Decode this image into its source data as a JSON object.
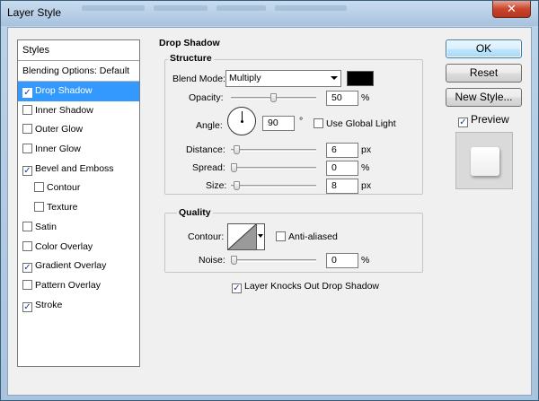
{
  "window": {
    "title": "Layer Style",
    "close_symbol": "✕"
  },
  "styles_list": {
    "header": "Styles",
    "blending_options": "Blending Options: Default",
    "items": [
      {
        "label": "Drop Shadow",
        "checked": true,
        "selected": true,
        "indent": false
      },
      {
        "label": "Inner Shadow",
        "checked": false,
        "selected": false,
        "indent": false
      },
      {
        "label": "Outer Glow",
        "checked": false,
        "selected": false,
        "indent": false
      },
      {
        "label": "Inner Glow",
        "checked": false,
        "selected": false,
        "indent": false
      },
      {
        "label": "Bevel and Emboss",
        "checked": true,
        "selected": false,
        "indent": false
      },
      {
        "label": "Contour",
        "checked": false,
        "selected": false,
        "indent": true
      },
      {
        "label": "Texture",
        "checked": false,
        "selected": false,
        "indent": true
      },
      {
        "label": "Satin",
        "checked": false,
        "selected": false,
        "indent": false
      },
      {
        "label": "Color Overlay",
        "checked": false,
        "selected": false,
        "indent": false
      },
      {
        "label": "Gradient Overlay",
        "checked": true,
        "selected": false,
        "indent": false
      },
      {
        "label": "Pattern Overlay",
        "checked": false,
        "selected": false,
        "indent": false
      },
      {
        "label": "Stroke",
        "checked": true,
        "selected": false,
        "indent": false
      }
    ]
  },
  "drop_shadow": {
    "title": "Drop Shadow",
    "structure": {
      "title": "Structure",
      "blend_mode_label": "Blend Mode:",
      "blend_mode_value": "Multiply",
      "shadow_color": "#000000",
      "opacity_label": "Opacity:",
      "opacity_value": "50",
      "opacity_fraction": 0.5,
      "opacity_unit": "%",
      "angle_label": "Angle:",
      "angle_value": "90",
      "angle_unit": "°",
      "use_global_light_label": "Use Global Light",
      "use_global_light_checked": false,
      "distance_label": "Distance:",
      "distance_value": "6",
      "distance_fraction": 0.03,
      "distance_unit": "px",
      "spread_label": "Spread:",
      "spread_value": "0",
      "spread_fraction": 0.0,
      "spread_unit": "%",
      "size_label": "Size:",
      "size_value": "8",
      "size_fraction": 0.04,
      "size_unit": "px"
    },
    "quality": {
      "title": "Quality",
      "contour_label": "Contour:",
      "anti_aliased_label": "Anti-aliased",
      "anti_aliased_checked": false,
      "noise_label": "Noise:",
      "noise_value": "0",
      "noise_fraction": 0.0,
      "noise_unit": "%"
    },
    "knocks_out_label": "Layer Knocks Out Drop Shadow",
    "knocks_out_checked": true
  },
  "buttons": {
    "ok": "OK",
    "reset": "Reset",
    "new_style": "New Style...",
    "preview_label": "Preview",
    "preview_checked": true
  },
  "colors": {
    "selection": "#3399ff",
    "dialog_bg": "#f0f0f0",
    "frame": "#b5cde5"
  }
}
